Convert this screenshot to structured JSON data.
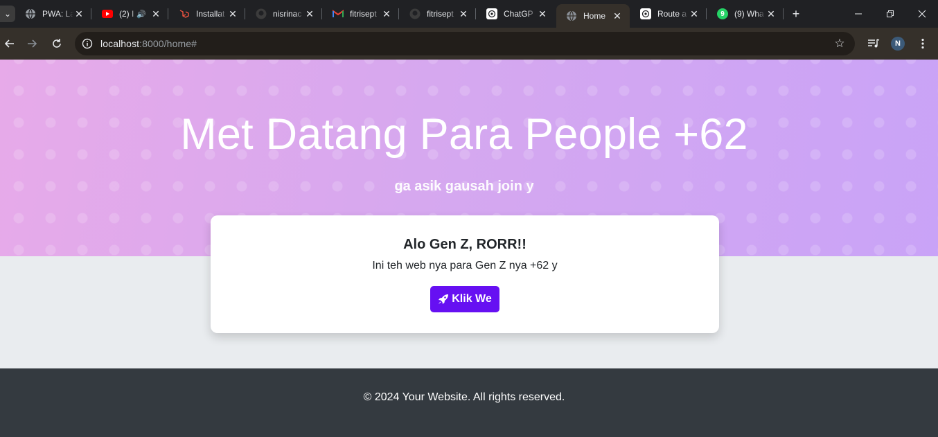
{
  "browser": {
    "tabs": [
      {
        "title": "PWA: La",
        "icon": "globe-icon"
      },
      {
        "title": "(2) I",
        "icon": "youtube-icon",
        "audio": true
      },
      {
        "title": "Installat",
        "icon": "laravel-icon"
      },
      {
        "title": "nisrinac",
        "icon": "github-icon"
      },
      {
        "title": "fitrisept",
        "icon": "gmail-icon"
      },
      {
        "title": "fitrisept",
        "icon": "github-icon"
      },
      {
        "title": "ChatGP",
        "icon": "chatgpt-icon"
      },
      {
        "title": "Home",
        "icon": "globe-icon",
        "active": true
      },
      {
        "title": "Route a",
        "icon": "chatgpt-icon"
      },
      {
        "title": "(9) Wha",
        "icon": "whatsapp-icon",
        "badge": "9"
      }
    ],
    "url_host": "localhost",
    "url_path": ":8000/home#",
    "profile_initial": "N",
    "colors": {
      "chrome_bg": "#202124",
      "toolbar_bg": "#35302a"
    }
  },
  "hero": {
    "title": "Met Datang Para People +62",
    "subtitle": "ga asik gausah join y"
  },
  "card": {
    "title": "Alo Gen Z, RORR!!",
    "text": "Ini teh web nya para Gen Z nya +62 y",
    "button_label": "Klik We",
    "button_icon": "rocket-icon",
    "button_color": "#6610f2"
  },
  "footer": {
    "text": "© 2024 Your Website. All rights reserved.",
    "bg_color": "#343a40"
  }
}
